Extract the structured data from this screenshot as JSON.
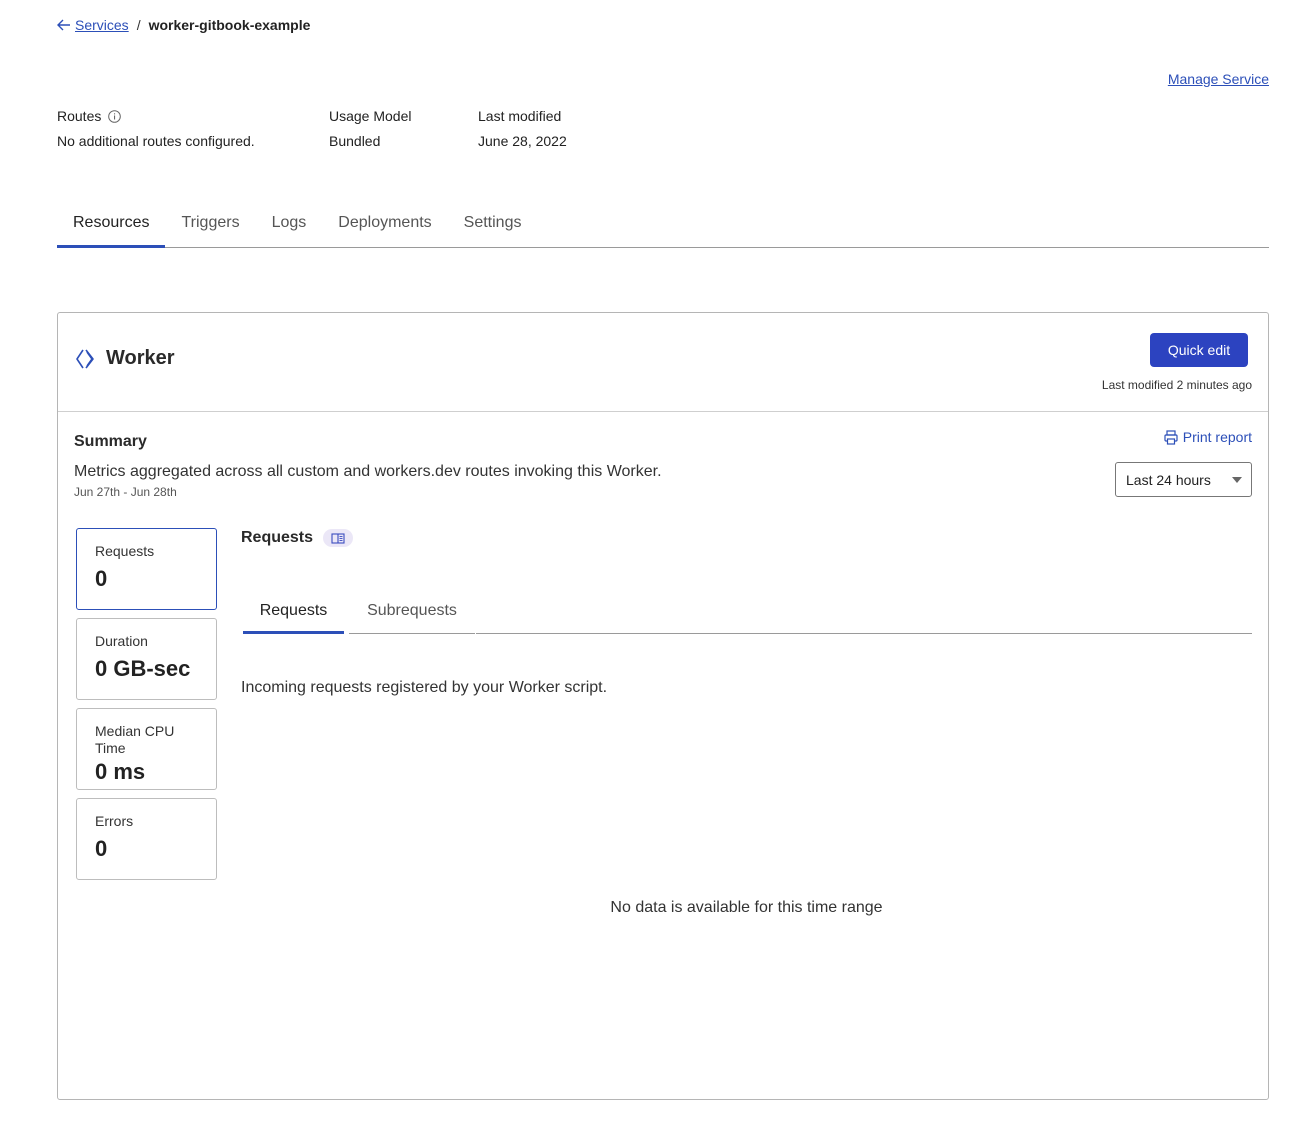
{
  "breadcrumb": {
    "back_label": "Services",
    "current": "worker-gitbook-example"
  },
  "header": {
    "manage_service_label": "Manage Service"
  },
  "meta": {
    "routes_label": "Routes",
    "routes_value": "No additional routes configured.",
    "usage_label": "Usage Model",
    "usage_value": "Bundled",
    "modified_label": "Last modified",
    "modified_value": "June 28, 2022"
  },
  "tabs": [
    {
      "label": "Resources",
      "active": true
    },
    {
      "label": "Triggers"
    },
    {
      "label": "Logs"
    },
    {
      "label": "Deployments"
    },
    {
      "label": "Settings"
    }
  ],
  "worker_card": {
    "title": "Worker",
    "quick_edit_label": "Quick edit",
    "last_modified": "Last modified 2 minutes ago",
    "summary_title": "Summary",
    "summary_desc": "Metrics aggregated across all custom and workers.dev routes invoking this Worker.",
    "summary_dates": "Jun 27th - Jun 28th",
    "print_report_label": "Print report",
    "time_range": {
      "selected": "Last 24 hours"
    },
    "stats": {
      "requests": {
        "label": "Requests",
        "value": "0"
      },
      "duration": {
        "label": "Duration",
        "value": "0 GB-sec"
      },
      "cpu": {
        "label": "Median CPU Time",
        "value": "0 ms"
      },
      "errors": {
        "label": "Errors",
        "value": "0"
      }
    },
    "chart": {
      "title": "Requests",
      "subtabs": [
        "Requests",
        "Subrequests"
      ],
      "description": "Incoming requests registered by your Worker script.",
      "empty_message": "No data is available for this time range"
    }
  },
  "colors": {
    "accent": "#2c43c0",
    "link": "#2c4fb8"
  }
}
